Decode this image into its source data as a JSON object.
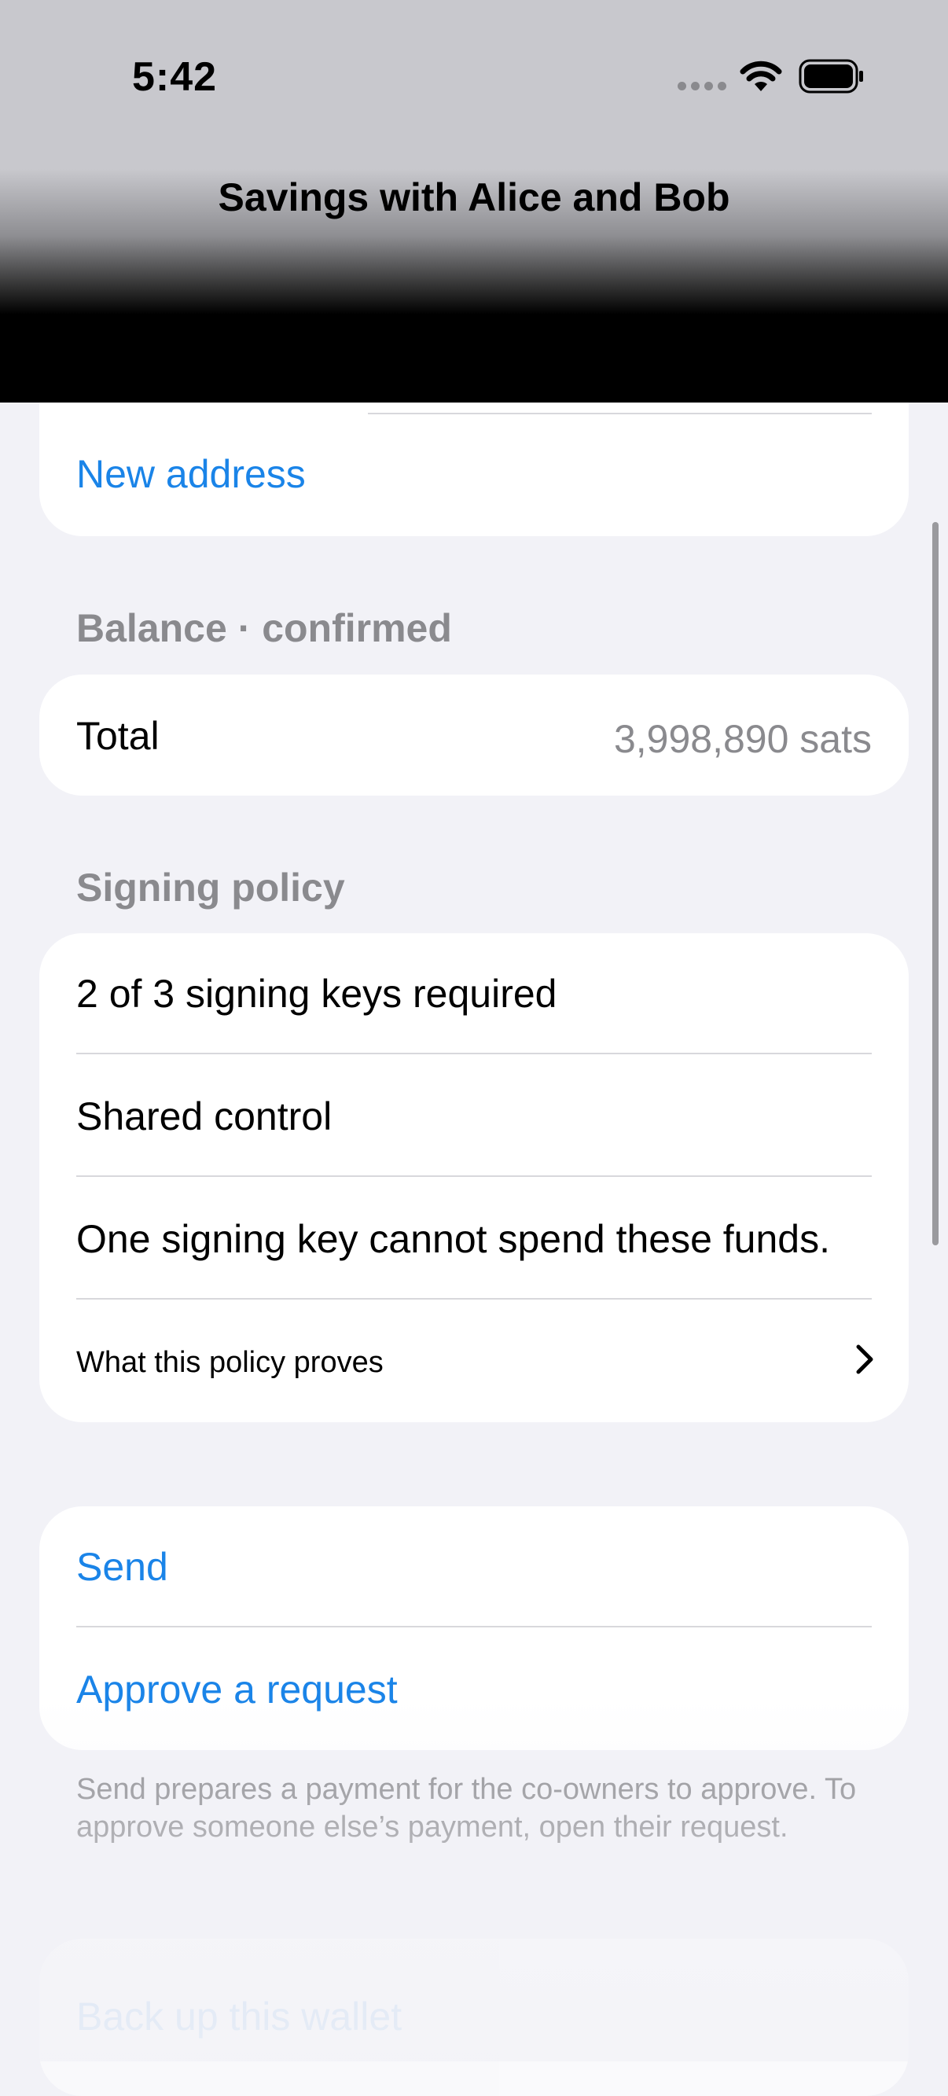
{
  "status_bar": {
    "time": "5:42"
  },
  "nav": {
    "title": "Savings with Alice and Bob"
  },
  "address_section": {
    "new_address_label": "New address"
  },
  "balance": {
    "header": "Balance · confirmed",
    "total_label": "Total",
    "total_value": "3,998,890 sats"
  },
  "signing_policy": {
    "header": "Signing policy",
    "rows": [
      "2 of 3 signing keys required",
      "Shared control",
      "One signing key cannot spend these funds."
    ],
    "proof_link": "What this policy proves"
  },
  "actions": {
    "send_label": "Send",
    "approve_label": "Approve a request",
    "footnote": "Send prepares a payment for the co-owners to approve. To approve someone else’s payment, open their request."
  },
  "backup": {
    "label": "Back up this wallet"
  },
  "colors": {
    "accent": "#1A84E8",
    "background": "#F2F2F7",
    "secondary_text": "#8A8A8E"
  }
}
